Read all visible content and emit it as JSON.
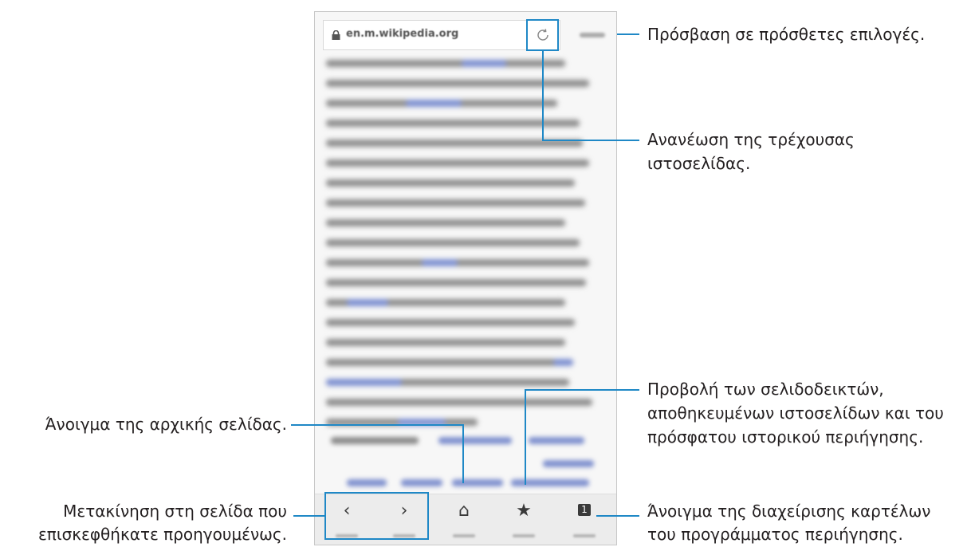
{
  "browser": {
    "url": "en.m.wikipedia.org",
    "bottom_nav": [
      {
        "name": "back",
        "glyph": "‹",
        "caption": "Back"
      },
      {
        "name": "forward",
        "glyph": "›",
        "caption": "Forward"
      },
      {
        "name": "home",
        "glyph": "⌂",
        "caption": "Home"
      },
      {
        "name": "bookmarks",
        "glyph": "★",
        "caption": "Bookmarks"
      },
      {
        "name": "tabs",
        "glyph": "1",
        "caption": "Tabs"
      }
    ]
  },
  "annotations": {
    "more_options": "Πρόσβαση σε πρόσθετες επιλογές.",
    "refresh_line1": "Ανανέωση της τρέχουσας",
    "refresh_line2": "ιστοσελίδας.",
    "bookmarks_line1": "Προβολή των σελιδοδεικτών,",
    "bookmarks_line2": "αποθηκευμένων ιστοσελίδων και του",
    "bookmarks_line3": "πρόσφατου ιστορικού περιήγησης.",
    "tabs_line1": "Άνοιγμα της διαχείρισης καρτέλων",
    "tabs_line2": "του προγράμματος περιήγησης.",
    "home": "Άνοιγμα της αρχικής σελίδας.",
    "back_line1": "Μετακίνηση στη σελίδα που",
    "back_line2": "επισκεφθήκατε προηγουμένως."
  },
  "colors": {
    "callout": "#1f88c6"
  }
}
